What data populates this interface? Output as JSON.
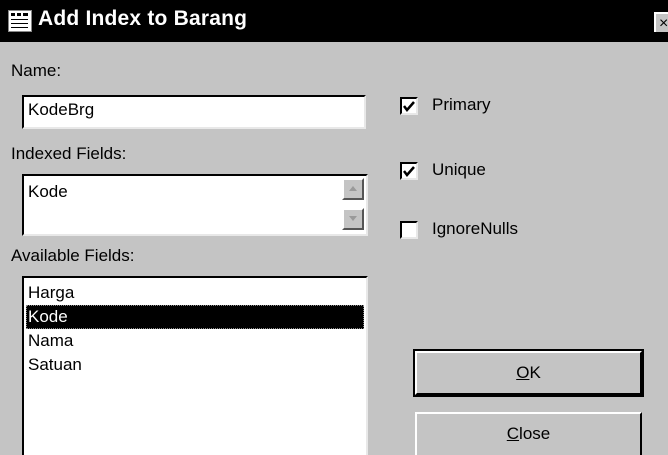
{
  "window": {
    "title": "Add Index to Barang",
    "app_icon": "database-app-icon",
    "close_glyph": "×"
  },
  "name_field": {
    "label": "Name:",
    "value": "KodeBrg"
  },
  "indexed_fields": {
    "label": "Indexed Fields:",
    "value": "Kode"
  },
  "available_fields": {
    "label": "Available Fields:",
    "items": [
      "Harga",
      "Kode",
      "Nama",
      "Satuan"
    ],
    "selected": "Kode"
  },
  "options": {
    "primary": {
      "label": "Primary",
      "checked": true
    },
    "unique": {
      "label": "Unique",
      "checked": true
    },
    "ignore_nulls": {
      "label": "IgnoreNulls",
      "checked": false
    }
  },
  "buttons": {
    "ok": {
      "mnemonic": "O",
      "rest": "K"
    },
    "close": {
      "mnemonic": "C",
      "rest": "lose"
    }
  }
}
